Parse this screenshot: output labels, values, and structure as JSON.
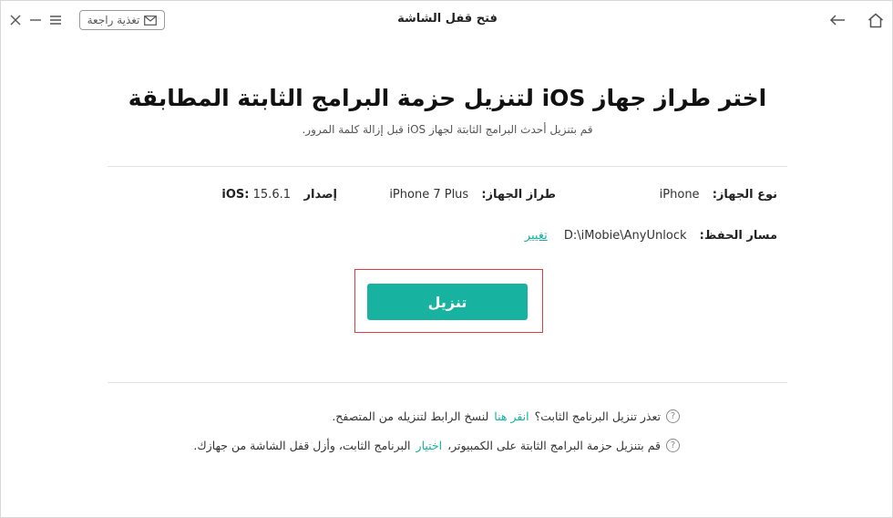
{
  "titlebar": {
    "title": "فتح قفل الشاشة",
    "feedback_label": "تغذية راجعة"
  },
  "icons": {
    "close": "close-icon",
    "minimize": "minimize-icon",
    "menu": "menu-icon",
    "mail": "mail-icon",
    "back": "back-arrow-icon",
    "home": "home-icon",
    "help": "question-circle-icon"
  },
  "main": {
    "headline": "اختر طراز جهاز iOS لتنزيل حزمة البرامج الثابتة المطابقة",
    "subhead": "قم بتنزيل أحدث البرامج الثابتة لجهاز iOS قبل إزالة كلمة المرور."
  },
  "device": {
    "type_label": "نوع الجهاز:",
    "type_value": "iPhone",
    "model_label": "طراز الجهاز:",
    "model_value": "iPhone 7 Plus",
    "ios_label": "إصدار iOS:",
    "ios_value": "15.6.1",
    "path_label": "مسار الحفظ:",
    "path_value": "D:\\iMobie\\AnyUnlock",
    "change_label": "تغيير"
  },
  "download_button_label": "تنزيل",
  "notes": {
    "note1_prefix": "تعذر تنزيل البرنامج الثابت؟",
    "note1_link": "انقر هنا",
    "note1_suffix": "لنسخ الرابط لتنزيله من المتصفح.",
    "note2_prefix": "قم بتنزيل حزمة البرامج الثابتة على الكمبيوتر،",
    "note2_link": "اختيار",
    "note2_suffix": "البرنامج الثابت، وأزل قفل الشاشة من جهازك."
  },
  "colors": {
    "accent": "#18b3a0",
    "highlight": "#e23b3b"
  }
}
